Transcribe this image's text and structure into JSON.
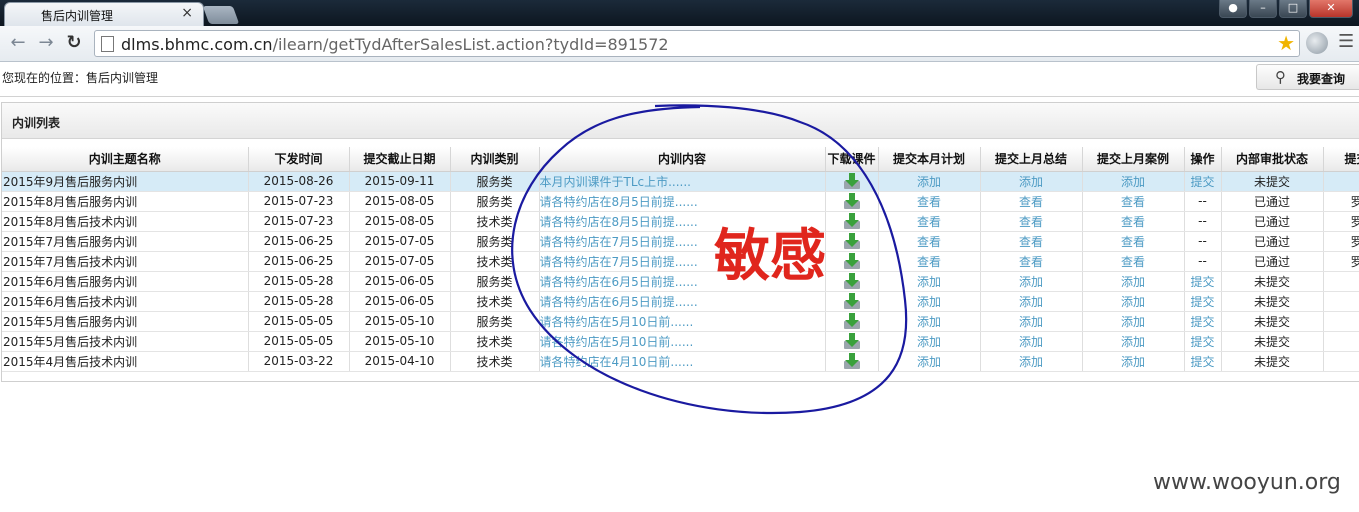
{
  "browser": {
    "tab_title": "售后内训管理",
    "close_glyph": "×",
    "url_host": "dlms.bhmc.com.cn",
    "url_path": "/ilearn/getTydAfterSalesList.action?tydId=891572",
    "icons": [
      "back-icon",
      "forward-icon",
      "reload-icon",
      "page-icon",
      "star-icon",
      "globe-icon",
      "wrench-icon"
    ]
  },
  "page": {
    "location": "您现在的位置：售后内训管理",
    "query_button": "我要查询",
    "panel_title": "内训列表"
  },
  "table": {
    "columns": [
      "内训主题名称",
      "下发时间",
      "提交截止日期",
      "内训类别",
      "内训内容",
      "下载课件",
      "提交本月计划",
      "提交上月总结",
      "提交上月案例",
      "操作",
      "内部审批状态",
      "提交人"
    ],
    "rows": [
      [
        "2015年9月售后服务内训",
        "2015-08-26",
        "2015-09-11",
        "服务类",
        "本月内训课件于TLc上市......",
        "添加",
        "添加",
        "添加",
        "提交",
        "未提交",
        ""
      ],
      [
        "2015年8月售后服务内训",
        "2015-07-23",
        "2015-08-05",
        "服务类",
        "请各特约店在8月5日前提......",
        "查看",
        "查看",
        "查看",
        "--",
        "已通过",
        "罗静"
      ],
      [
        "2015年8月售后技术内训",
        "2015-07-23",
        "2015-08-05",
        "技术类",
        "请各特约店在8月5日前提......",
        "查看",
        "查看",
        "查看",
        "--",
        "已通过",
        "罗静"
      ],
      [
        "2015年7月售后服务内训",
        "2015-06-25",
        "2015-07-05",
        "服务类",
        "请各特约店在7月5日前提......",
        "查看",
        "查看",
        "查看",
        "--",
        "已通过",
        "罗静"
      ],
      [
        "2015年7月售后技术内训",
        "2015-06-25",
        "2015-07-05",
        "技术类",
        "请各特约店在7月5日前提......",
        "查看",
        "查看",
        "查看",
        "--",
        "已通过",
        "罗静"
      ],
      [
        "2015年6月售后服务内训",
        "2015-05-28",
        "2015-06-05",
        "服务类",
        "请各特约店在6月5日前提......",
        "添加",
        "添加",
        "添加",
        "提交",
        "未提交",
        ""
      ],
      [
        "2015年6月售后技术内训",
        "2015-05-28",
        "2015-06-05",
        "技术类",
        "请各特约店在6月5日前提......",
        "添加",
        "添加",
        "添加",
        "提交",
        "未提交",
        ""
      ],
      [
        "2015年5月售后服务内训",
        "2015-05-05",
        "2015-05-10",
        "服务类",
        "请各特约店在5月10日前......",
        "添加",
        "添加",
        "添加",
        "提交",
        "未提交",
        ""
      ],
      [
        "2015年5月售后技术内训",
        "2015-05-05",
        "2015-05-10",
        "技术类",
        "请各特约店在5月10日前......",
        "添加",
        "添加",
        "添加",
        "提交",
        "未提交",
        ""
      ],
      [
        "2015年4月售后技术内训",
        "2015-03-22",
        "2015-04-10",
        "技术类",
        "请各特约店在4月10日前......",
        "添加",
        "添加",
        "添加",
        "提交",
        "未提交",
        ""
      ]
    ]
  },
  "annotation": {
    "stamp": "敏感",
    "color": "#e0261d",
    "circle_color": "#1a1aa0"
  },
  "watermark": "www.wooyun.org"
}
